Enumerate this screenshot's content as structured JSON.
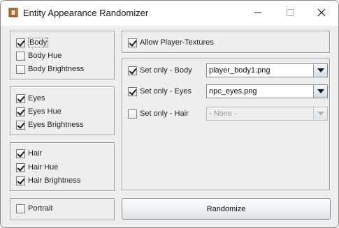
{
  "window": {
    "title": "Entity Appearance Randomizer"
  },
  "body_group": {
    "body": "Body",
    "body_hue": "Body Hue",
    "body_brightness": "Body Brightness"
  },
  "eyes_group": {
    "eyes": "Eyes",
    "eyes_hue": "Eyes Hue",
    "eyes_brightness": "Eyes Brightness"
  },
  "hair_group": {
    "hair": "Hair",
    "hair_hue": "Hair Hue",
    "hair_brightness": "Hair Brightness"
  },
  "portrait": {
    "label": "Portrait"
  },
  "allow_textures": {
    "label": "Allow Player-Textures"
  },
  "set_only": {
    "body": {
      "label": "Set only - Body",
      "value": "player_body1.png"
    },
    "eyes": {
      "label": "Set only - Eyes",
      "value": "npc_eyes.png"
    },
    "hair": {
      "label": "Set only - Hair",
      "value": "- None -"
    }
  },
  "randomize_button": {
    "label": "Randomize"
  },
  "icons": {
    "app": "app-frame-icon",
    "minimize": "minimize-icon",
    "maximize": "maximize-icon",
    "close": "close-icon",
    "dropdown": "dropdown-arrow-icon",
    "check": "checkmark-icon"
  },
  "checked": {
    "body": true,
    "body_hue": false,
    "body_brightness": false,
    "eyes": true,
    "eyes_hue": true,
    "eyes_brightness": true,
    "hair": true,
    "hair_hue": true,
    "hair_brightness": true,
    "portrait": false,
    "allow_textures": true,
    "set_only_body": true,
    "set_only_eyes": true,
    "set_only_hair": false
  }
}
